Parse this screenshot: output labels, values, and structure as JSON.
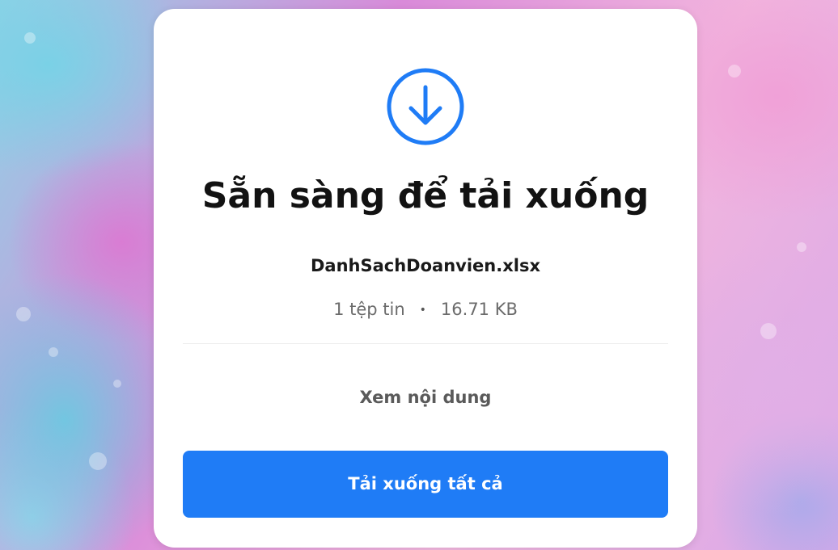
{
  "dialog": {
    "title": "Sẵn sàng để tải xuống",
    "file_name": "DanhSachDoanvien.xlsx",
    "file_count": "1 tệp tin",
    "separator": "•",
    "file_size": "16.71 KB",
    "view_label": "Xem nội dung",
    "download_all_label": "Tải xuống tất cả"
  },
  "icons": {
    "main": "download-circle-icon"
  },
  "colors": {
    "accent": "#1f7cf6",
    "icon": "#1f7cf6",
    "title": "#121212",
    "meta": "#6b6b6b",
    "card": "#ffffff"
  }
}
